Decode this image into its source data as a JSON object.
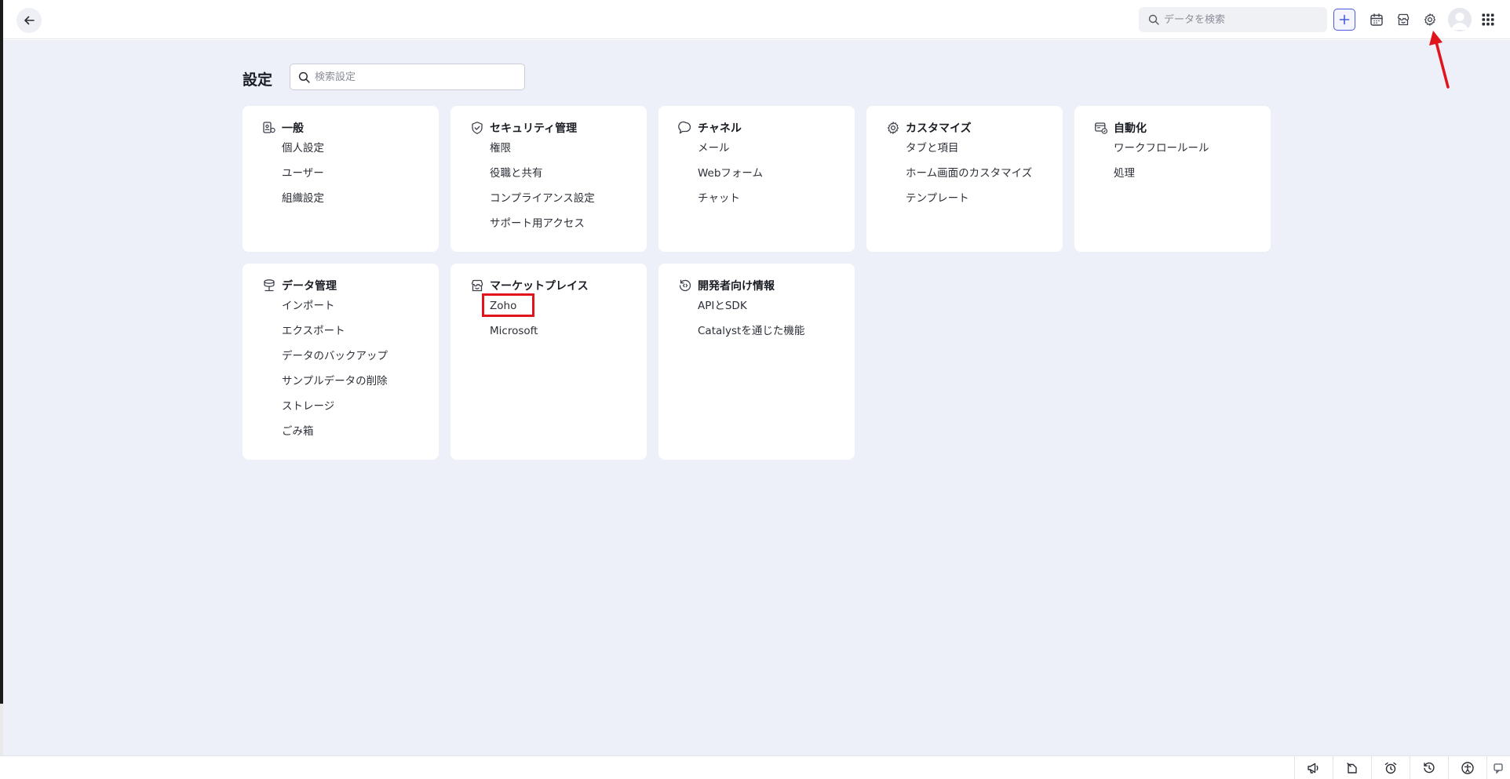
{
  "header": {
    "search_placeholder": "データを検索"
  },
  "settings": {
    "title": "設定",
    "search_placeholder": "検索設定"
  },
  "cards": [
    {
      "title": "一般",
      "icon": "user-card-icon",
      "items": [
        "個人設定",
        "ユーザー",
        "組織設定"
      ]
    },
    {
      "title": "セキュリティ管理",
      "icon": "shield-icon",
      "items": [
        "権限",
        "役職と共有",
        "コンプライアンス設定",
        "サポート用アクセス"
      ]
    },
    {
      "title": "チャネル",
      "icon": "chat-bubble-icon",
      "items": [
        "メール",
        "Webフォーム",
        "チャット"
      ]
    },
    {
      "title": "カスタマイズ",
      "icon": "gear-icon",
      "items": [
        "タブと項目",
        "ホーム画面のカスタマイズ",
        "テンプレート"
      ]
    },
    {
      "title": "自動化",
      "icon": "automation-icon",
      "items": [
        "ワークフロールール",
        "処理"
      ]
    },
    {
      "title": "データ管理",
      "icon": "database-icon",
      "items": [
        "インポート",
        "エクスポート",
        "データのバックアップ",
        "サンプルデータの削除",
        "ストレージ",
        "ごみ箱"
      ]
    },
    {
      "title": "マーケットプレイス",
      "icon": "store-icon",
      "items": [
        "Zoho",
        "Microsoft"
      ]
    },
    {
      "title": "開発者向け情報",
      "icon": "developer-icon",
      "items": [
        "APIとSDK",
        "Catalystを通じた機能"
      ]
    }
  ],
  "colors": {
    "accent": "#4a5bdc",
    "page_bg": "#edf0f8",
    "highlight": "#e2141b"
  }
}
